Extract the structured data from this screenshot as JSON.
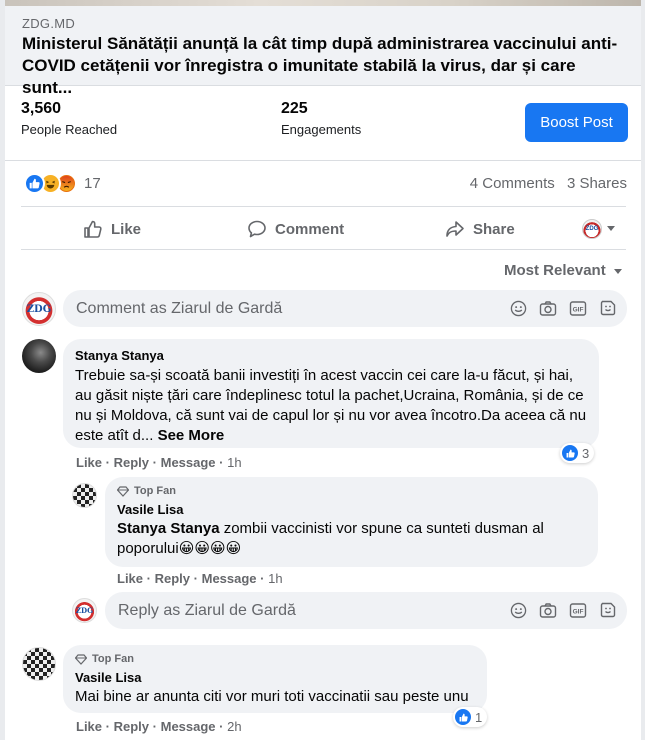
{
  "link_preview": {
    "domain": "ZDG.MD",
    "title": "Ministerul Sănătății anunță la cât timp după administrarea vaccinului anti-COVID cetățenii vor înregistra o imunitate stabilă la virus, dar și care sunt..."
  },
  "insights": {
    "people_reached_value": "3,560",
    "people_reached_label": "People Reached",
    "engagements_value": "225",
    "engagements_label": "Engagements",
    "boost_label": "Boost Post"
  },
  "reactions": {
    "icons": [
      "like-icon",
      "haha-icon",
      "angry-icon"
    ],
    "count": "17",
    "comments": "4 Comments",
    "shares": "3 Shares"
  },
  "actions": {
    "like": "Like",
    "comment": "Comment",
    "share": "Share"
  },
  "sort": {
    "label": "Most Relevant"
  },
  "comment_input": {
    "placeholder": "Comment as Ziarul de Gardă"
  },
  "avatar_text": "ZDG",
  "comments": [
    {
      "author": "Stanya Stanya",
      "text": "Trebuie sa-și scoată banii investiți în acest vaccin cei care la-u făcut, și hai, au găsit niște țări care îndeplinesc totul la pachet,Ucraina, România, și de ce nu și Moldova, că sunt vai de capul lor și nu vor avea încotro.Da aceea că nu este atît d...",
      "see_more": "See More",
      "like": "Like",
      "reply": "Reply",
      "message": "Message",
      "time": "1h",
      "reaction_count": "3",
      "replies": [
        {
          "badge": "Top Fan",
          "author": "Vasile Lisa",
          "mention": "Stanya Stanya",
          "text": "zombii vaccinisti vor spune ca sunteti dusman al poporului😀😀😀😀",
          "like": "Like",
          "reply": "Reply",
          "message": "Message",
          "time": "1h"
        }
      ],
      "reply_input": {
        "placeholder": "Reply as Ziarul de Gardă"
      }
    },
    {
      "badge": "Top Fan",
      "author": "Vasile Lisa",
      "text": "Mai bine ar anunta citi vor muri toti vaccinatii sau peste unu",
      "like": "Like",
      "reply": "Reply",
      "message": "Message",
      "time": "2h",
      "reaction_count": "1"
    }
  ],
  "separator": "·",
  "colors": {
    "accent": "#1877f2",
    "secondary_text": "#65676b",
    "bubble_bg": "#f0f2f5"
  }
}
